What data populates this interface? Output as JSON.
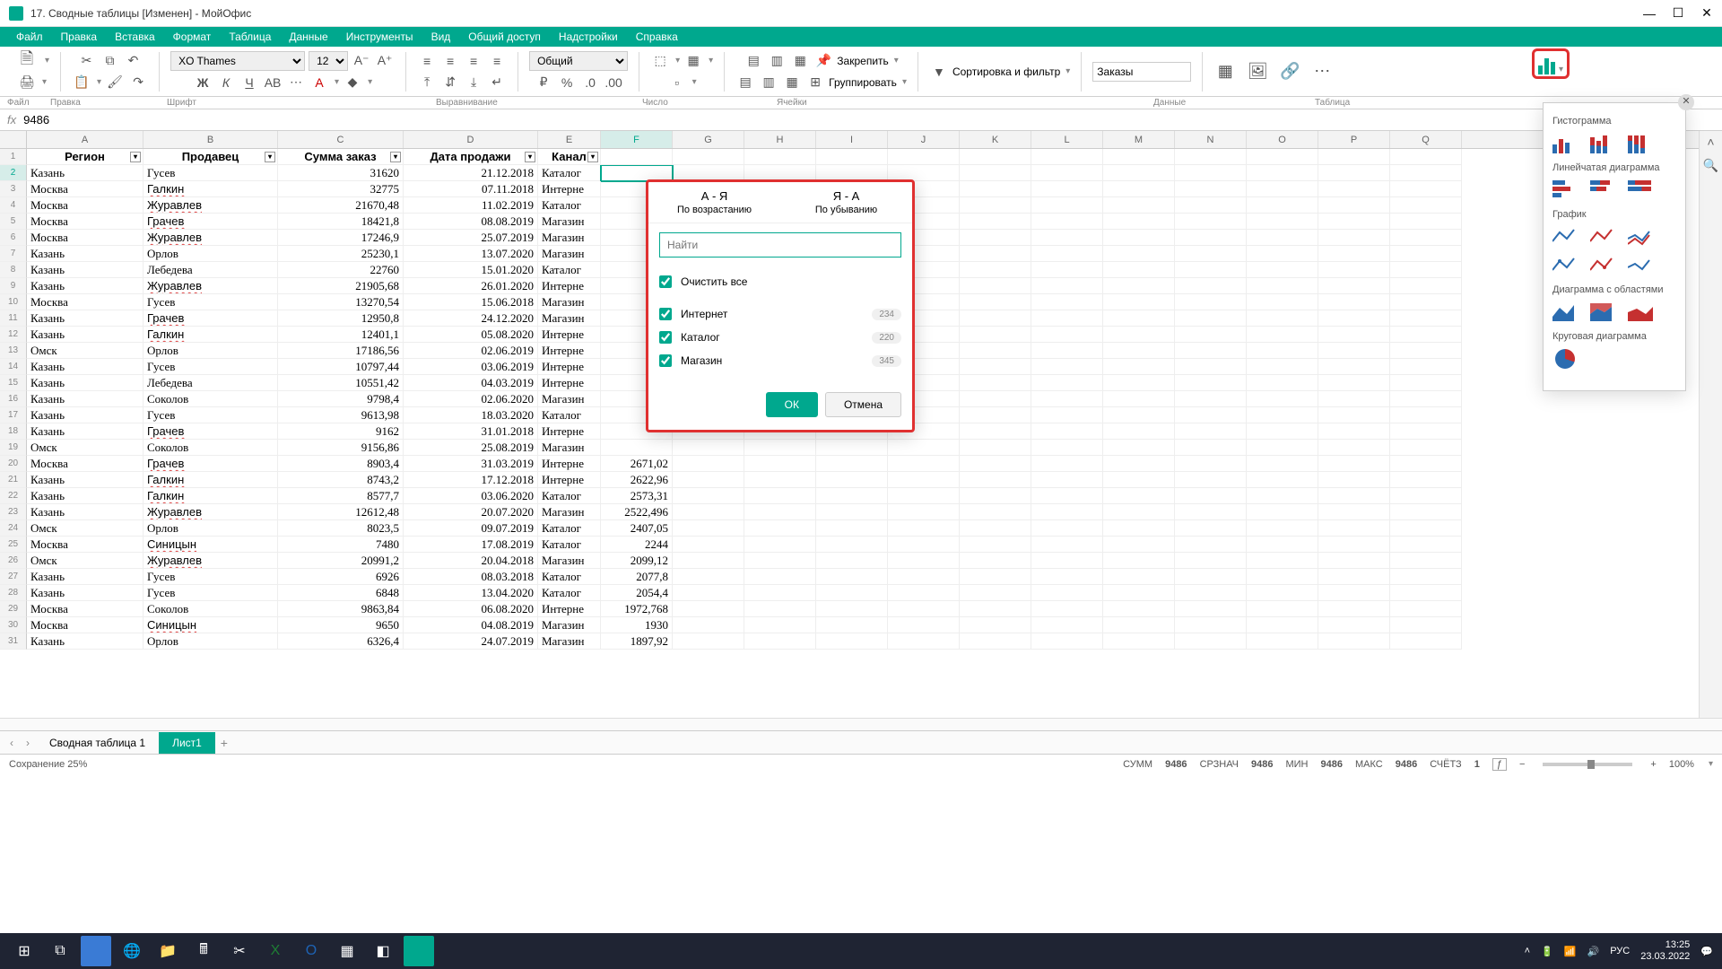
{
  "window": {
    "title": "17. Сводные таблицы [Изменен] - МойОфис"
  },
  "menu": [
    "Файл",
    "Правка",
    "Вставка",
    "Формат",
    "Таблица",
    "Данные",
    "Инструменты",
    "Вид",
    "Общий доступ",
    "Надстройки",
    "Справка"
  ],
  "ribbon": {
    "font_name": "XO Thames",
    "font_size": "12",
    "number_format": "Общий",
    "pin_label": "Закрепить",
    "group_label": "Группировать",
    "sort_filter_label": "Сортировка и фильтр",
    "table_name": "Заказы",
    "groups": [
      "Файл",
      "Правка",
      "Шрифт",
      "Выравнивание",
      "Число",
      "Ячейки",
      "",
      "",
      "Данные",
      "Таблица"
    ]
  },
  "formula": {
    "fx": "fx",
    "value": "9486"
  },
  "columns": [
    "A",
    "B",
    "C",
    "D",
    "E",
    "F",
    "G",
    "H",
    "I",
    "J",
    "K",
    "L",
    "M",
    "N",
    "O",
    "P",
    "Q"
  ],
  "headers": {
    "region": "Регион",
    "seller": "Продавец",
    "order_sum": "Сумма заказ",
    "sale_date": "Дата продажи",
    "channel": "Канал"
  },
  "rows": [
    {
      "n": 2,
      "r": "Казань",
      "s": "Гусев",
      "sum": "31620",
      "d": "21.12.2018",
      "c": "Каталог",
      "f": ""
    },
    {
      "n": 3,
      "r": "Москва",
      "s": "Галкин",
      "sum": "32775",
      "d": "07.11.2018",
      "c": "Интерне",
      "f": ""
    },
    {
      "n": 4,
      "r": "Москва",
      "s": "Журавлев",
      "sum": "21670,48",
      "d": "11.02.2019",
      "c": "Каталог",
      "f": ""
    },
    {
      "n": 5,
      "r": "Москва",
      "s": "Грачев",
      "sum": "18421,8",
      "d": "08.08.2019",
      "c": "Магазин",
      "f": ""
    },
    {
      "n": 6,
      "r": "Москва",
      "s": "Журавлев",
      "sum": "17246,9",
      "d": "25.07.2019",
      "c": "Магазин",
      "f": ""
    },
    {
      "n": 7,
      "r": "Казань",
      "s": "Орлов",
      "sum": "25230,1",
      "d": "13.07.2020",
      "c": "Магазин",
      "f": ""
    },
    {
      "n": 8,
      "r": "Казань",
      "s": "Лебедева",
      "sum": "22760",
      "d": "15.01.2020",
      "c": "Каталог",
      "f": ""
    },
    {
      "n": 9,
      "r": "Казань",
      "s": "Журавлев",
      "sum": "21905,68",
      "d": "26.01.2020",
      "c": "Интерне",
      "f": ""
    },
    {
      "n": 10,
      "r": "Москва",
      "s": "Гусев",
      "sum": "13270,54",
      "d": "15.06.2018",
      "c": "Магазин",
      "f": ""
    },
    {
      "n": 11,
      "r": "Казань",
      "s": "Грачев",
      "sum": "12950,8",
      "d": "24.12.2020",
      "c": "Магазин",
      "f": ""
    },
    {
      "n": 12,
      "r": "Казань",
      "s": "Галкин",
      "sum": "12401,1",
      "d": "05.08.2020",
      "c": "Интерне",
      "f": ""
    },
    {
      "n": 13,
      "r": "Омск",
      "s": "Орлов",
      "sum": "17186,56",
      "d": "02.06.2019",
      "c": "Интерне",
      "f": ""
    },
    {
      "n": 14,
      "r": "Казань",
      "s": "Гусев",
      "sum": "10797,44",
      "d": "03.06.2019",
      "c": "Интерне",
      "f": ""
    },
    {
      "n": 15,
      "r": "Казань",
      "s": "Лебедева",
      "sum": "10551,42",
      "d": "04.03.2019",
      "c": "Интерне",
      "f": ""
    },
    {
      "n": 16,
      "r": "Казань",
      "s": "Соколов",
      "sum": "9798,4",
      "d": "02.06.2020",
      "c": "Магазин",
      "f": ""
    },
    {
      "n": 17,
      "r": "Казань",
      "s": "Гусев",
      "sum": "9613,98",
      "d": "18.03.2020",
      "c": "Каталог",
      "f": ""
    },
    {
      "n": 18,
      "r": "Казань",
      "s": "Грачев",
      "sum": "9162",
      "d": "31.01.2018",
      "c": "Интерне",
      "f": ""
    },
    {
      "n": 19,
      "r": "Омск",
      "s": "Соколов",
      "sum": "9156,86",
      "d": "25.08.2019",
      "c": "Магазин",
      "f": ""
    },
    {
      "n": 20,
      "r": "Москва",
      "s": "Грачев",
      "sum": "8903,4",
      "d": "31.03.2019",
      "c": "Интерне",
      "f": "2671,02"
    },
    {
      "n": 21,
      "r": "Казань",
      "s": "Галкин",
      "sum": "8743,2",
      "d": "17.12.2018",
      "c": "Интерне",
      "f": "2622,96"
    },
    {
      "n": 22,
      "r": "Казань",
      "s": "Галкин",
      "sum": "8577,7",
      "d": "03.06.2020",
      "c": "Каталог",
      "f": "2573,31"
    },
    {
      "n": 23,
      "r": "Казань",
      "s": "Журавлев",
      "sum": "12612,48",
      "d": "20.07.2020",
      "c": "Магазин",
      "f": "2522,496"
    },
    {
      "n": 24,
      "r": "Омск",
      "s": "Орлов",
      "sum": "8023,5",
      "d": "09.07.2019",
      "c": "Каталог",
      "f": "2407,05"
    },
    {
      "n": 25,
      "r": "Москва",
      "s": "Синицын",
      "sum": "7480",
      "d": "17.08.2019",
      "c": "Каталог",
      "f": "2244"
    },
    {
      "n": 26,
      "r": "Омск",
      "s": "Журавлев",
      "sum": "20991,2",
      "d": "20.04.2018",
      "c": "Магазин",
      "f": "2099,12"
    },
    {
      "n": 27,
      "r": "Казань",
      "s": "Гусев",
      "sum": "6926",
      "d": "08.03.2018",
      "c": "Каталог",
      "f": "2077,8"
    },
    {
      "n": 28,
      "r": "Казань",
      "s": "Гусев",
      "sum": "6848",
      "d": "13.04.2020",
      "c": "Каталог",
      "f": "2054,4"
    },
    {
      "n": 29,
      "r": "Москва",
      "s": "Соколов",
      "sum": "9863,84",
      "d": "06.08.2020",
      "c": "Интерне",
      "f": "1972,768"
    },
    {
      "n": 30,
      "r": "Москва",
      "s": "Синицын",
      "sum": "9650",
      "d": "04.08.2019",
      "c": "Магазин",
      "f": "1930"
    },
    {
      "n": 31,
      "r": "Казань",
      "s": "Орлов",
      "sum": "6326,4",
      "d": "24.07.2019",
      "c": "Магазин",
      "f": "1897,92"
    }
  ],
  "filter_popup": {
    "sort_asc_title": "А - Я",
    "sort_asc_sub": "По возрастанию",
    "sort_desc_title": "Я - А",
    "sort_desc_sub": "По убыванию",
    "search_placeholder": "Найти",
    "clear_all": "Очистить все",
    "items": [
      {
        "label": "Интернет",
        "count": "234"
      },
      {
        "label": "Каталог",
        "count": "220"
      },
      {
        "label": "Магазин",
        "count": "345"
      }
    ],
    "ok": "ОК",
    "cancel": "Отмена"
  },
  "chart_panel": {
    "histogram": "Гистограмма",
    "bar": "Линейчатая диаграмма",
    "line": "График",
    "area": "Диаграмма с областями",
    "pie": "Круговая диаграмма"
  },
  "sheets": {
    "tab1": "Сводная таблица 1",
    "tab2": "Лист1"
  },
  "status": {
    "saving": "Сохранение 25%",
    "sum_l": "СУММ",
    "sum_v": "9486",
    "avg_l": "СРЗНАЧ",
    "avg_v": "9486",
    "min_l": "МИН",
    "min_v": "9486",
    "max_l": "МАКС",
    "max_v": "9486",
    "count_l": "СЧЁТЗ",
    "count_v": "1",
    "zoom": "100%"
  },
  "tray": {
    "lang": "РУС",
    "time": "13:25",
    "date": "23.03.2022"
  },
  "squiggle_sellers": [
    "Галкин",
    "Журавлев",
    "Грачев",
    "Синицын"
  ]
}
